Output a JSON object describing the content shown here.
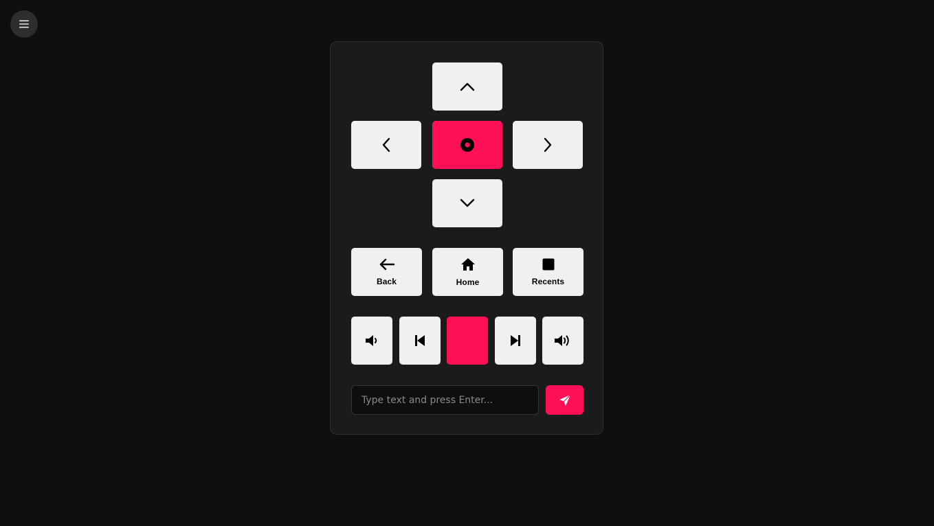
{
  "menu": {
    "icon": "hamburger-menu-icon"
  },
  "dpad": {
    "up_icon": "chevron-up-icon",
    "left_icon": "chevron-left-icon",
    "ok_icon": "circle-dot-icon",
    "right_icon": "chevron-right-icon",
    "down_icon": "chevron-down-icon"
  },
  "nav": {
    "back_label": "Back",
    "back_icon": "arrow-left-icon",
    "home_label": "Home",
    "home_icon": "home-icon",
    "recents_label": "Recents",
    "recents_icon": "square-icon"
  },
  "media": {
    "volume_down_icon": "volume-down-icon",
    "previous_icon": "skip-previous-icon",
    "next_icon": "skip-next-icon",
    "volume_up_icon": "volume-up-icon"
  },
  "text_input": {
    "value": "",
    "placeholder": "Type text and press Enter..."
  },
  "send": {
    "icon": "send-icon"
  },
  "colors": {
    "background": "#0f0f0f",
    "panel": "#1b1b1b",
    "key": "#f0f0f0",
    "accent": "#ff0f55"
  }
}
